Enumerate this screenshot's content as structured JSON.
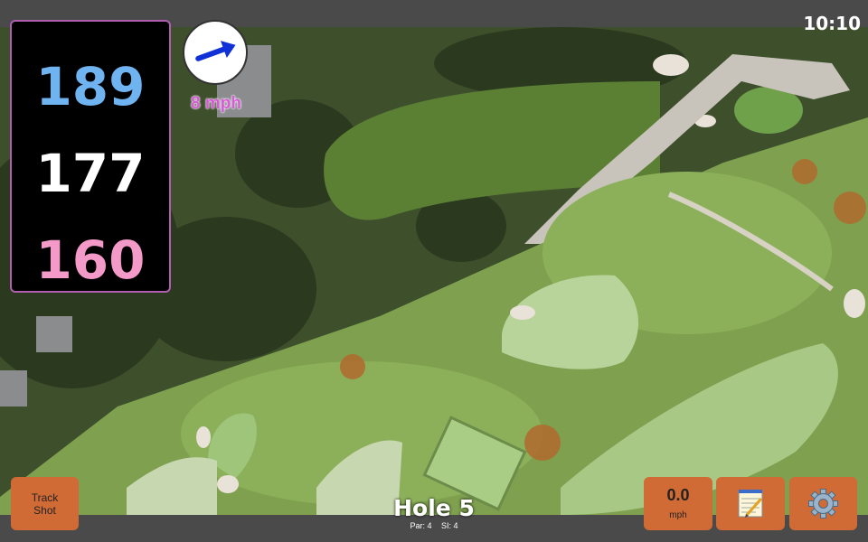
{
  "status": {
    "time": "10:10"
  },
  "distances": {
    "back": "189",
    "middle": "177",
    "front": "160"
  },
  "wind": {
    "speed_label": "8 mph",
    "direction": "north-east"
  },
  "bottom": {
    "track_shot_label": "Track\nShot",
    "wind_value": "0.0",
    "wind_unit": "mph",
    "hole_title": "Hole 5",
    "par": "Par: 4",
    "si": "SI: 4"
  },
  "icons": {
    "notes": "notepad-icon",
    "settings": "gear-icon",
    "wind": "arrow-icon"
  },
  "colors": {
    "back_distance": "#6fb3f0",
    "middle_distance": "#ffffff",
    "front_distance": "#f49ac8",
    "button": "#d16b36",
    "panel_border": "#b05fb0"
  }
}
